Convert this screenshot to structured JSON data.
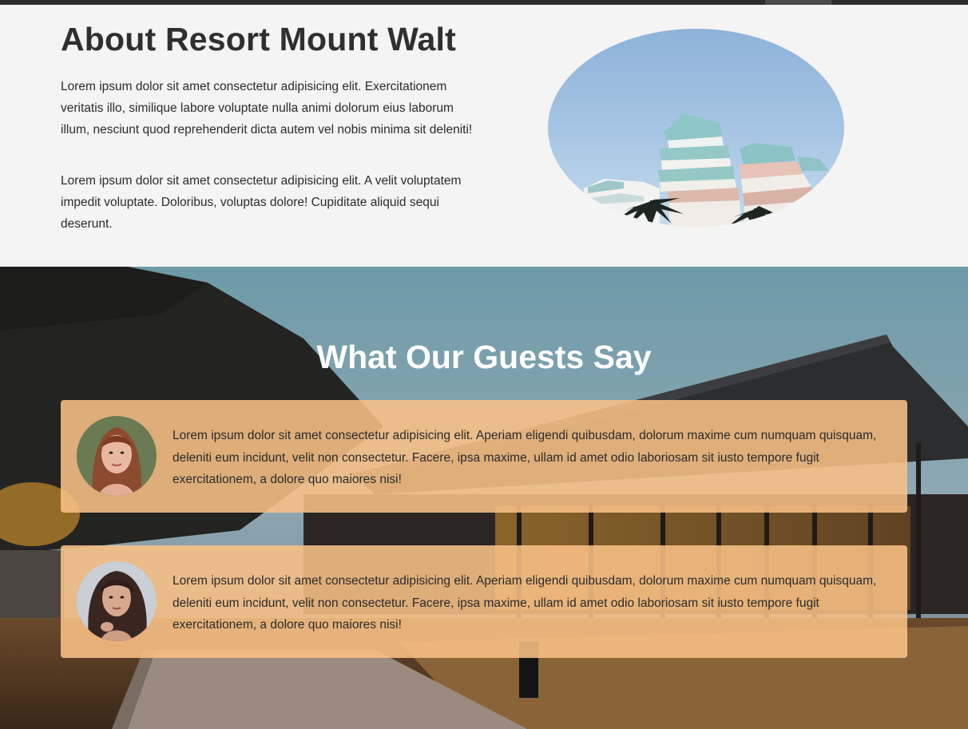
{
  "about": {
    "title": "About Resort Mount Walt",
    "paragraph1": "Lorem ipsum dolor sit amet consectetur adipisicing elit. Exercitationem veritatis illo, similique labore voluptate nulla animi dolorum eius laborum illum, nesciunt quod reprehenderit dicta autem vel nobis minima sit deleniti!",
    "paragraph2": "Lorem ipsum dolor sit amet consectetur adipisicing elit. A velit voluptatem impedit voluptate. Doloribus, voluptas dolore! Cupiditate aliquid sequi deserunt."
  },
  "testimonials": {
    "title": "What Our Guests Say",
    "items": [
      {
        "text": "Lorem ipsum dolor sit amet consectetur adipisicing elit. Aperiam eligendi quibusdam, dolorum maxime cum numquam quisquam, deleniti eum incidunt, velit non consectetur. Facere, ipsa maxime, ullam id amet odio laboriosam sit iusto tempore fugit exercitationem, a dolore quo maiores nisi!"
      },
      {
        "text": "Lorem ipsum dolor sit amet consectetur adipisicing elit. Aperiam eligendi quibusdam, dolorum maxime cum numquam quisquam, deleniti eum incidunt, velit non consectetur. Facere, ipsa maxime, ullam id amet odio laboriosam sit iusto tempore fugit exercitationem, a dolore quo maiores nisi!"
      }
    ]
  },
  "colors": {
    "topbar": "#2e2e2e",
    "card_background": "#f8c085",
    "heading_light": "#ffffff",
    "heading_dark": "#2f2f2f"
  }
}
